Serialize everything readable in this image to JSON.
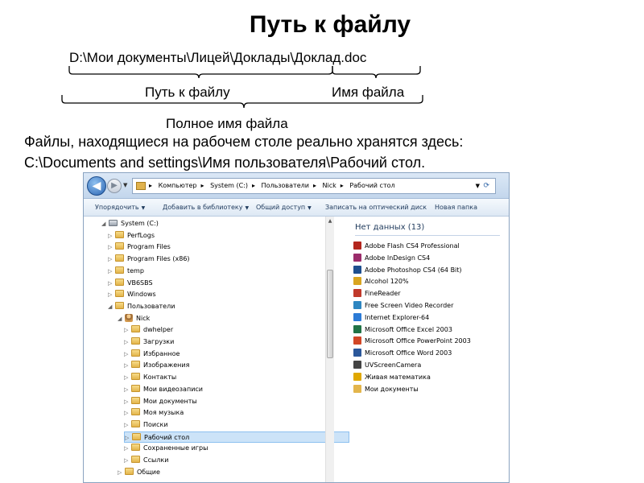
{
  "slide": {
    "title": "Путь к файлу",
    "full_path": "D:\\Мои документы\\Лицей\\Доклады\\Доклад.doc",
    "label_path": "Путь к файлу",
    "label_filename": "Имя файла",
    "label_fullname": "Полное имя файла",
    "desc_line1": "Файлы, находящиеся на рабочем столе реально хранятся здесь:",
    "desc_line2": "C:\\Documents and settings\\Имя пользователя\\Рабочий стол."
  },
  "explorer": {
    "breadcrumb": [
      "Компьютер",
      "System (C:)",
      "Пользователи",
      "Nick",
      "Рабочий стол"
    ],
    "toolbar": {
      "organize": "Упорядочить",
      "add_library": "Добавить в библиотеку",
      "share": "Общий доступ",
      "burn": "Записать на оптический диск",
      "new_folder": "Новая папка"
    },
    "tree": [
      {
        "label": "System (C:)",
        "level": 0,
        "expanded": true,
        "icon": "drive-icon"
      },
      {
        "label": "PerfLogs",
        "level": 1,
        "expanded": false,
        "icon": "folder-icon"
      },
      {
        "label": "Program Files",
        "level": 1,
        "expanded": false,
        "icon": "folder-icon"
      },
      {
        "label": "Program Files (x86)",
        "level": 1,
        "expanded": false,
        "icon": "folder-icon"
      },
      {
        "label": "temp",
        "level": 1,
        "expanded": false,
        "icon": "folder-icon"
      },
      {
        "label": "VB6SBS",
        "level": 1,
        "expanded": false,
        "icon": "folder-icon"
      },
      {
        "label": "Windows",
        "level": 1,
        "expanded": false,
        "icon": "folder-icon"
      },
      {
        "label": "Пользователи",
        "level": 1,
        "expanded": true,
        "icon": "folder-icon"
      },
      {
        "label": "Nick",
        "level": 2,
        "expanded": true,
        "icon": "user-folder-icon"
      },
      {
        "label": "dwhelper",
        "level": 3,
        "expanded": false,
        "icon": "folder-icon"
      },
      {
        "label": "Загрузки",
        "level": 3,
        "expanded": false,
        "icon": "folder-icon"
      },
      {
        "label": "Избранное",
        "level": 3,
        "expanded": false,
        "icon": "folder-icon"
      },
      {
        "label": "Изображения",
        "level": 3,
        "expanded": false,
        "icon": "folder-icon"
      },
      {
        "label": "Контакты",
        "level": 3,
        "expanded": false,
        "icon": "folder-icon"
      },
      {
        "label": "Мои видеозаписи",
        "level": 3,
        "expanded": false,
        "icon": "folder-icon"
      },
      {
        "label": "Мои документы",
        "level": 3,
        "expanded": false,
        "icon": "folder-icon"
      },
      {
        "label": "Моя музыка",
        "level": 3,
        "expanded": false,
        "icon": "folder-icon"
      },
      {
        "label": "Поиски",
        "level": 3,
        "expanded": false,
        "icon": "folder-icon"
      },
      {
        "label": "Рабочий стол",
        "level": 3,
        "expanded": false,
        "icon": "folder-icon",
        "selected": true
      },
      {
        "label": "Сохраненные игры",
        "level": 3,
        "expanded": false,
        "icon": "folder-icon"
      },
      {
        "label": "Ссылки",
        "level": 3,
        "expanded": false,
        "icon": "folder-icon"
      },
      {
        "label": "Общие",
        "level": 2,
        "expanded": false,
        "icon": "folder-icon"
      }
    ],
    "group_header": "Нет данных (13)",
    "files": [
      {
        "label": "Adobe Flash CS4 Professional",
        "icon": "flash-icon",
        "color": "#b3261e"
      },
      {
        "label": "Adobe InDesign CS4",
        "icon": "indesign-icon",
        "color": "#9b2c6b"
      },
      {
        "label": "Adobe Photoshop CS4 (64 Bit)",
        "icon": "photoshop-icon",
        "color": "#1e4f8f"
      },
      {
        "label": "Alcohol 120%",
        "icon": "alcohol-icon",
        "color": "#d9a520"
      },
      {
        "label": "FineReader",
        "icon": "finereader-icon",
        "color": "#c0392b"
      },
      {
        "label": "Free Screen Video Recorder",
        "icon": "recorder-icon",
        "color": "#2e86c1"
      },
      {
        "label": "Internet Explorer-64",
        "icon": "ie-icon",
        "color": "#2c7bd6"
      },
      {
        "label": "Microsoft Office Excel 2003",
        "icon": "excel-icon",
        "color": "#217346"
      },
      {
        "label": "Microsoft Office PowerPoint 2003",
        "icon": "powerpoint-icon",
        "color": "#d24726"
      },
      {
        "label": "Microsoft Office Word 2003",
        "icon": "word-icon",
        "color": "#2b579a"
      },
      {
        "label": "UVScreenCamera",
        "icon": "camera-icon",
        "color": "#444444"
      },
      {
        "label": "Живая математика",
        "icon": "math-icon",
        "color": "#e0a800"
      },
      {
        "label": "Мои документы",
        "icon": "folder-icon",
        "color": "#e3b54c"
      }
    ]
  }
}
